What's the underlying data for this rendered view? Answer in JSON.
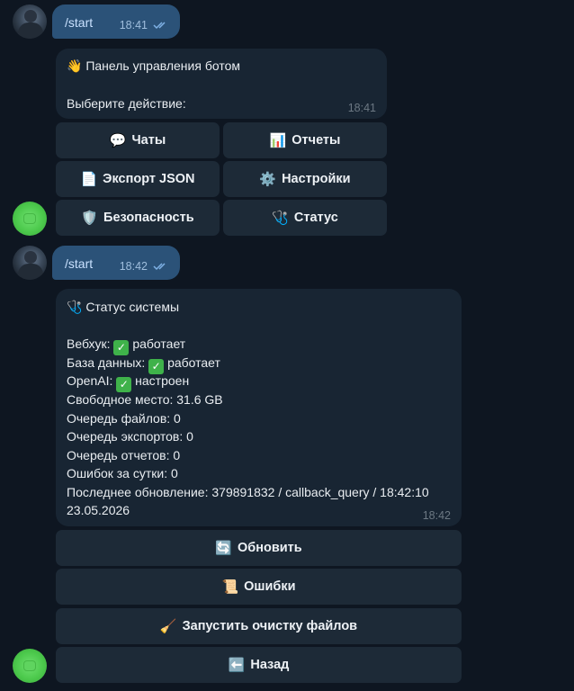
{
  "msg1": {
    "command": "/start",
    "time": "18:41"
  },
  "panel": {
    "title": "👋 Панель управления ботом",
    "prompt": "Выберите действие:",
    "time": "18:41",
    "buttons": [
      {
        "icon": "💬",
        "label": "Чаты",
        "icon_name": "speech-bubble-icon"
      },
      {
        "icon": "📊",
        "label": "Отчеты",
        "icon_name": "bar-chart-icon"
      },
      {
        "icon": "📄",
        "label": "Экспорт JSON",
        "icon_name": "document-icon"
      },
      {
        "icon": "⚙️",
        "label": "Настройки",
        "icon_name": "gear-icon"
      },
      {
        "icon": "🛡️",
        "label": "Безопасность",
        "icon_name": "shield-icon"
      },
      {
        "icon": "🩺",
        "label": "Статус",
        "icon_name": "stethoscope-icon"
      }
    ]
  },
  "msg2": {
    "command": "/start",
    "time": "18:42"
  },
  "status": {
    "title": "🩺 Статус системы",
    "webhook_label": "Вебхук:",
    "webhook_value": "работает",
    "db_label": "База данных:",
    "db_value": "работает",
    "openai_label": "OpenAI:",
    "openai_value": "настроен",
    "free_space": "Свободное место: 31.6 GB",
    "file_queue": "Очередь файлов: 0",
    "export_queue": "Очередь экспортов: 0",
    "report_queue": "Очередь отчетов: 0",
    "errors_day": "Ошибок за сутки: 0",
    "last_update": "Последнее обновление: 379891832 / callback_query / 18:42:10",
    "last_update_date": "23.05.2026",
    "time": "18:42",
    "buttons": [
      {
        "icon": "🔄",
        "label": "Обновить",
        "icon_name": "refresh-icon"
      },
      {
        "icon": "📜",
        "label": "Ошибки",
        "icon_name": "scroll-icon"
      },
      {
        "icon": "🧹",
        "label": "Запустить очистку файлов",
        "icon_name": "broom-icon"
      },
      {
        "icon": "⬅️",
        "label": "Назад",
        "icon_name": "back-arrow-icon"
      }
    ]
  },
  "colors": {
    "background": "#0e1621",
    "outgoing": "#2b5278",
    "incoming": "#182533",
    "keyboard": "#1d2a37",
    "check": "#3fb24a"
  }
}
